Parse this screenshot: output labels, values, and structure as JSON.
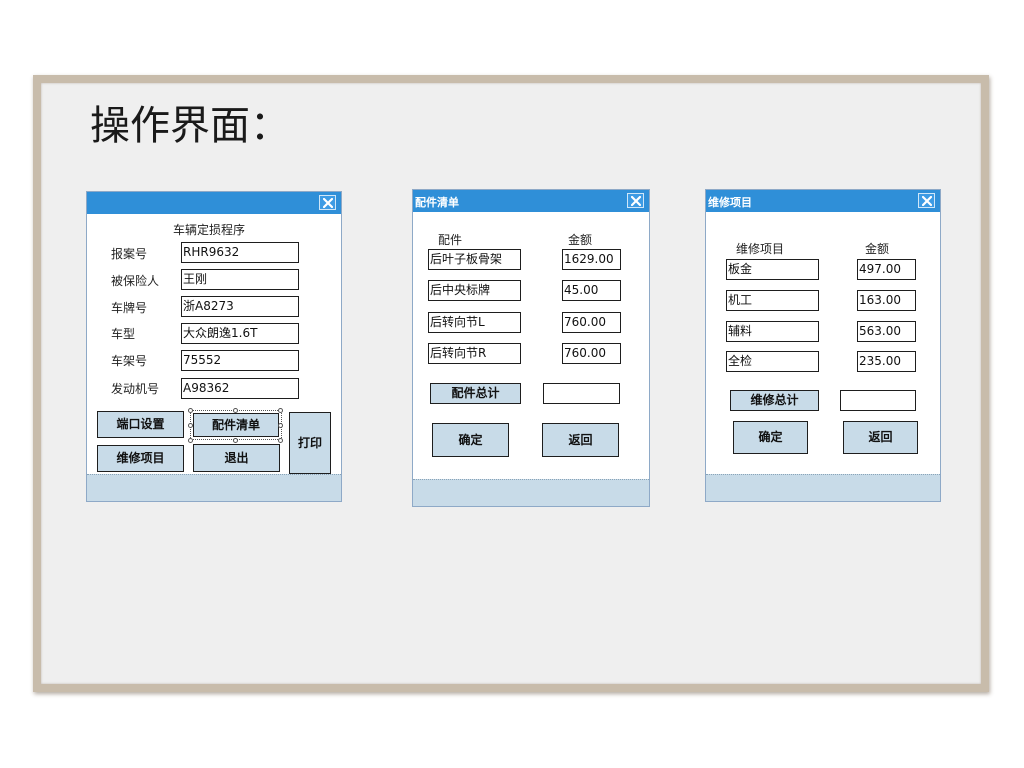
{
  "slide": {
    "title": "操作界面："
  },
  "main_window": {
    "title": "",
    "heading": "车辆定损程序",
    "fields": [
      {
        "label": "报案号",
        "value": "RHR9632"
      },
      {
        "label": "被保险人",
        "value": "王刚"
      },
      {
        "label": "车牌号",
        "value": "浙A8273"
      },
      {
        "label": "车型",
        "value": "大众朗逸1.6T"
      },
      {
        "label": "车架号",
        "value": "75552"
      },
      {
        "label": "发动机号",
        "value": "A98362"
      }
    ],
    "buttons": {
      "port_settings": "端口设置",
      "parts_list": "配件清单",
      "print": "打印",
      "repair_items": "维修项目",
      "exit": "退出"
    }
  },
  "parts_window": {
    "title": "配件清单",
    "col_item": "配件",
    "col_amount": "金额",
    "rows": [
      {
        "item": "后叶子板骨架",
        "amount": "1629.00"
      },
      {
        "item": "后中央标牌",
        "amount": "45.00"
      },
      {
        "item": "后转向节L",
        "amount": "760.00"
      },
      {
        "item": "后转向节R",
        "amount": "760.00"
      }
    ],
    "total_label": "配件总计",
    "total_value": "",
    "confirm": "确定",
    "back": "返回"
  },
  "repair_window": {
    "title": "维修项目",
    "col_item": "维修项目",
    "col_amount": "金额",
    "rows": [
      {
        "item": "板金",
        "amount": "497.00"
      },
      {
        "item": "机工",
        "amount": "163.00"
      },
      {
        "item": "辅料",
        "amount": "563.00"
      },
      {
        "item": "全检",
        "amount": "235.00"
      }
    ],
    "total_label": "维修总计",
    "total_value": "",
    "confirm": "确定",
    "back": "返回"
  },
  "icons": {
    "close": "close-icon"
  },
  "colors": {
    "titlebar": "#2f8fd8",
    "button_fill": "#c8dbe8",
    "footer": "#c8dbe8",
    "slide_bg": "#efefef",
    "slide_border": "#c8bcab"
  }
}
